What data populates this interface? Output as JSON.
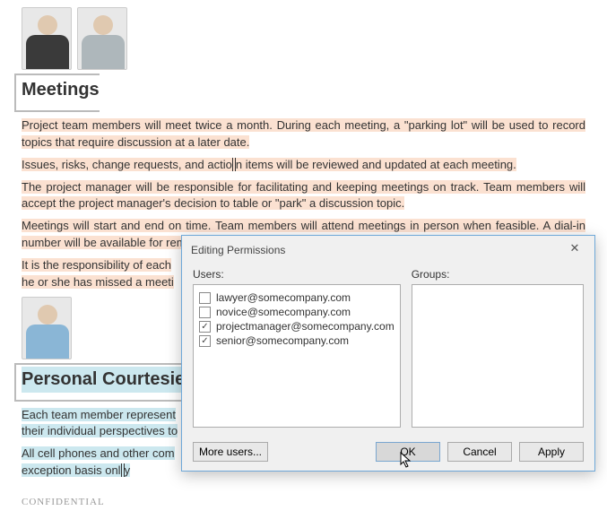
{
  "sections": {
    "meetings": {
      "heading": "Meetings",
      "p1": "Project team members will meet twice a month. During each meeting, a \"parking lot\" will be used to record topics that require discussion at a later date.",
      "p2a": "Issues, risks, change requests, and actio",
      "p2b": "n items will be reviewed and updated at each meeting.",
      "p3": "The project manager will be responsible for facilitating and keeping meetings on track. Team members will accept the project manager's decision to table or \"park\" a discussion topic.",
      "p4": "Meetings will start and end on time. Team members will attend meetings in person when feasible. A dial-in number will be available for remote attendance.",
      "p5": "It is the responsibility of each",
      "p6": "he or she has missed a meeti"
    },
    "courtesies": {
      "heading": "Personal Courtesies",
      "p1": "Each team member represent",
      "p2": "their individual perspectives to",
      "p3": "All cell phones and other com",
      "p4a": "exception basis onl",
      "p4b": "y"
    }
  },
  "footer": "CONFIDENTIAL",
  "dialog": {
    "title": "Editing Permissions",
    "users_label": "Users:",
    "groups_label": "Groups:",
    "users": [
      {
        "email": "lawyer@somecompany.com",
        "checked": false
      },
      {
        "email": "novice@somecompany.com",
        "checked": false
      },
      {
        "email": "projectmanager@somecompany.com",
        "checked": true
      },
      {
        "email": "senior@somecompany.com",
        "checked": true
      }
    ],
    "more_users": "More users...",
    "ok": "OK",
    "cancel": "Cancel",
    "apply": "Apply"
  }
}
